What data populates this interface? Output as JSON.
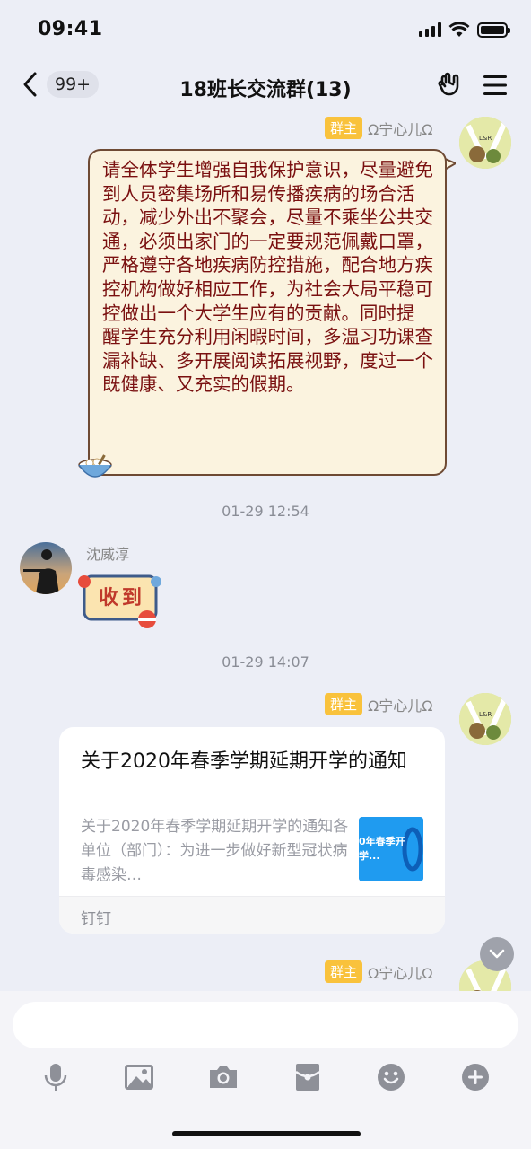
{
  "status_bar": {
    "time": "09:41"
  },
  "nav": {
    "back_badge": "99+",
    "title": "18班长交流群(13)"
  },
  "messages": {
    "first": {
      "tag": "群主",
      "sender": "Ω宁心儿Ω",
      "text": "请全体学生增强自我保护意识，尽量避免到人员密集场所和易传播疾病的场合活动，减少外出不聚会，尽量不乘坐公共交通，必须出家门的一定要规范佩戴口罩，严格遵守各地疾病防控措施，配合地方疾控机构做好相应工作，为社会大局平稳可控做出一个大学生应有的贡献。同时提\n醒学生充分利用闲暇时间，多温习功课查漏补缺、多开展阅读拓展视野，度过一个既健康、又充实的假期。"
    },
    "timestamp_1": "01-29 12:54",
    "second": {
      "sender": "沈威淳",
      "sticker_text": "收到"
    },
    "timestamp_2": "01-29 14:07",
    "third": {
      "tag": "群主",
      "sender": "Ω宁心儿Ω",
      "card_title": "关于2020年春季学期延期开学的通知",
      "card_desc": "关于2020年春季学期延期开学的通知各单位（部门）：为进一步做好新型冠状病毒感染…",
      "card_thumb_text": "0年春季开学...",
      "card_source": "钉钉"
    },
    "fourth": {
      "tag": "群主",
      "sender": "Ω宁心儿Ω"
    }
  },
  "input": {
    "placeholder": ""
  },
  "toolbar": {
    "icons": [
      "microphone-icon",
      "image-icon",
      "camera-icon",
      "red-packet-icon",
      "emoji-icon",
      "plus-icon"
    ]
  },
  "colors": {
    "background": "#eceef6",
    "owner_tag": "#f9c23c",
    "notice_bubble": "#fbf3df",
    "notice_text": "#7a1010"
  }
}
